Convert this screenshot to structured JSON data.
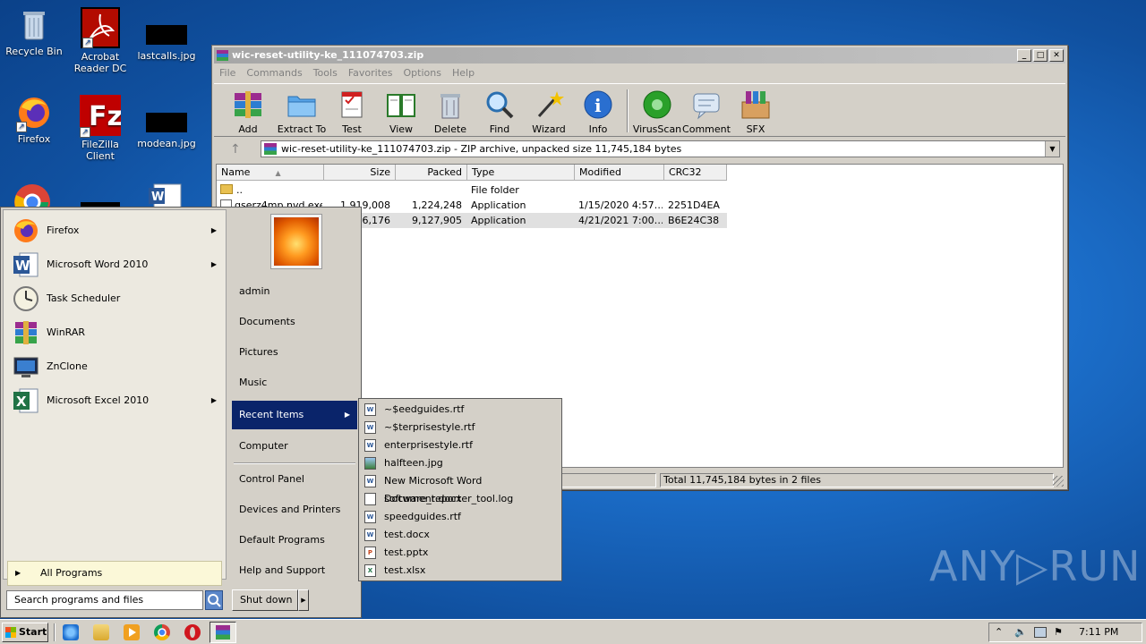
{
  "desktop": {
    "icons": [
      {
        "label": "Recycle Bin",
        "name": "recycle-bin-icon"
      },
      {
        "label": "Acrobat Reader DC",
        "name": "acrobat-icon"
      },
      {
        "label": "lastcalls.jpg",
        "name": "file-icon"
      },
      {
        "label": "Firefox",
        "name": "firefox-icon"
      },
      {
        "label": "FileZilla Client",
        "name": "filezilla-icon"
      },
      {
        "label": "modean.jpg",
        "name": "file-icon"
      }
    ]
  },
  "winrar": {
    "title": "wic-reset-utility-ke_111074703.zip",
    "menu": [
      "File",
      "Commands",
      "Tools",
      "Favorites",
      "Options",
      "Help"
    ],
    "toolbar": [
      "Add",
      "Extract To",
      "Test",
      "View",
      "Delete",
      "Find",
      "Wizard",
      "Info",
      "VirusScan",
      "Comment",
      "SFX"
    ],
    "address": "wic-reset-utility-ke_111074703.zip - ZIP archive, unpacked size 11,745,184 bytes",
    "columns": {
      "name": "Name",
      "size": "Size",
      "packed": "Packed",
      "type": "Type",
      "modified": "Modified",
      "crc": "CRC32"
    },
    "rows": [
      {
        "name": "..",
        "size": "",
        "packed": "",
        "type": "File folder",
        "modified": "",
        "crc": ""
      },
      {
        "name": "qserz4mp.nvd.exe",
        "size": "1,919,008",
        "packed": "1,224,248",
        "type": "Application",
        "modified": "1/15/2020 4:57…",
        "crc": "2251D4EA"
      },
      {
        "name": "",
        "size": "6,176",
        "packed": "9,127,905",
        "type": "Application",
        "modified": "4/21/2021 7:00…",
        "crc": "B6E24C38"
      }
    ],
    "status_right": "Total 11,745,184 bytes in 2 files"
  },
  "startmenu": {
    "programs": [
      {
        "label": "Firefox",
        "arrow": true
      },
      {
        "label": "Microsoft Word 2010",
        "arrow": true
      },
      {
        "label": "Task Scheduler",
        "arrow": false
      },
      {
        "label": "WinRAR",
        "arrow": false
      },
      {
        "label": "ZnClone",
        "arrow": false
      },
      {
        "label": "Microsoft Excel 2010",
        "arrow": true
      }
    ],
    "all_programs": "All Programs",
    "search_placeholder": "Search programs and files",
    "right_items": [
      "admin",
      "Documents",
      "Pictures",
      "Music",
      "Recent Items",
      "Computer",
      "Control Panel",
      "Devices and Printers",
      "Default Programs",
      "Help and Support"
    ],
    "shutdown": "Shut down",
    "recent": [
      {
        "label": "~$eedguides.rtf",
        "kind": "W"
      },
      {
        "label": "~$terprisestyle.rtf",
        "kind": "W"
      },
      {
        "label": "enterprisestyle.rtf",
        "kind": "W"
      },
      {
        "label": "halfteen.jpg",
        "kind": "img"
      },
      {
        "label": "New Microsoft Word Document.docx",
        "kind": "W"
      },
      {
        "label": "software_reporter_tool.log",
        "kind": "txt"
      },
      {
        "label": "speedguides.rtf",
        "kind": "W"
      },
      {
        "label": "test.docx",
        "kind": "W"
      },
      {
        "label": "test.pptx",
        "kind": "P"
      },
      {
        "label": "test.xlsx",
        "kind": "X"
      }
    ]
  },
  "taskbar": {
    "start": "Start",
    "clock": "7:11 PM"
  },
  "watermark": "ANY▷RUN",
  "colors": {
    "accent": "#1c6fcb",
    "menu_highlight": "#0a246a"
  }
}
